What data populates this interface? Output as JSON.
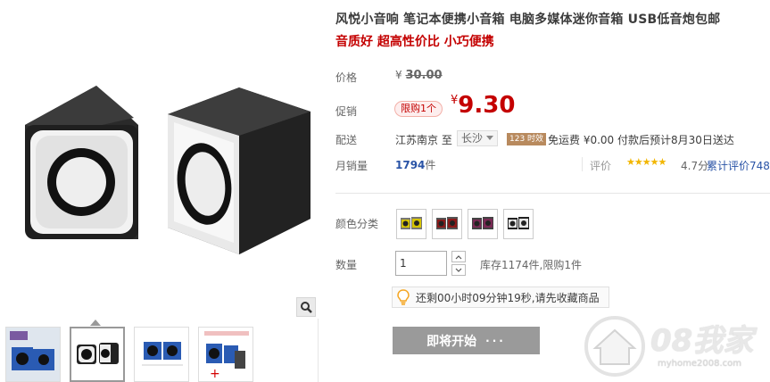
{
  "product": {
    "title": "风悦小音响 笔记本便携小音箱 电脑多媒体迷你音箱 USB低音炮包邮",
    "subtitle": "音质好 超高性价比 小巧便携"
  },
  "price": {
    "label": "价格",
    "currency": "¥",
    "original": "30.00"
  },
  "promo": {
    "label": "促销",
    "limit_tag": "限购1个",
    "currency": "¥",
    "price": "9.30"
  },
  "shipping": {
    "label": "配送",
    "from": "江苏南京 至",
    "to": "长沙",
    "badge": "123 时效",
    "free_text": "免运费 ¥0.00 付款后预计8月30日送达"
  },
  "sales": {
    "label": "月销量",
    "count": "1794",
    "unit": "件",
    "rating_label": "评价",
    "stars": "★★★★★",
    "score": "4.7分",
    "reviews_link": "累计评价748"
  },
  "options": {
    "color_label": "颜色分类",
    "swatch_colors": [
      "#d6c400",
      "#8b1a1a",
      "#7a2a55",
      "#222222"
    ],
    "qty_label": "数量",
    "qty_value": "1",
    "stock": "库存1174件,限购1件",
    "favorite_notice": "还剩00小时09分钟19秒,请先收藏商品",
    "start_button": "即将开始",
    "start_dots": "···"
  },
  "watermark": {
    "brand": "08我家",
    "url": "myhome2008.com"
  }
}
